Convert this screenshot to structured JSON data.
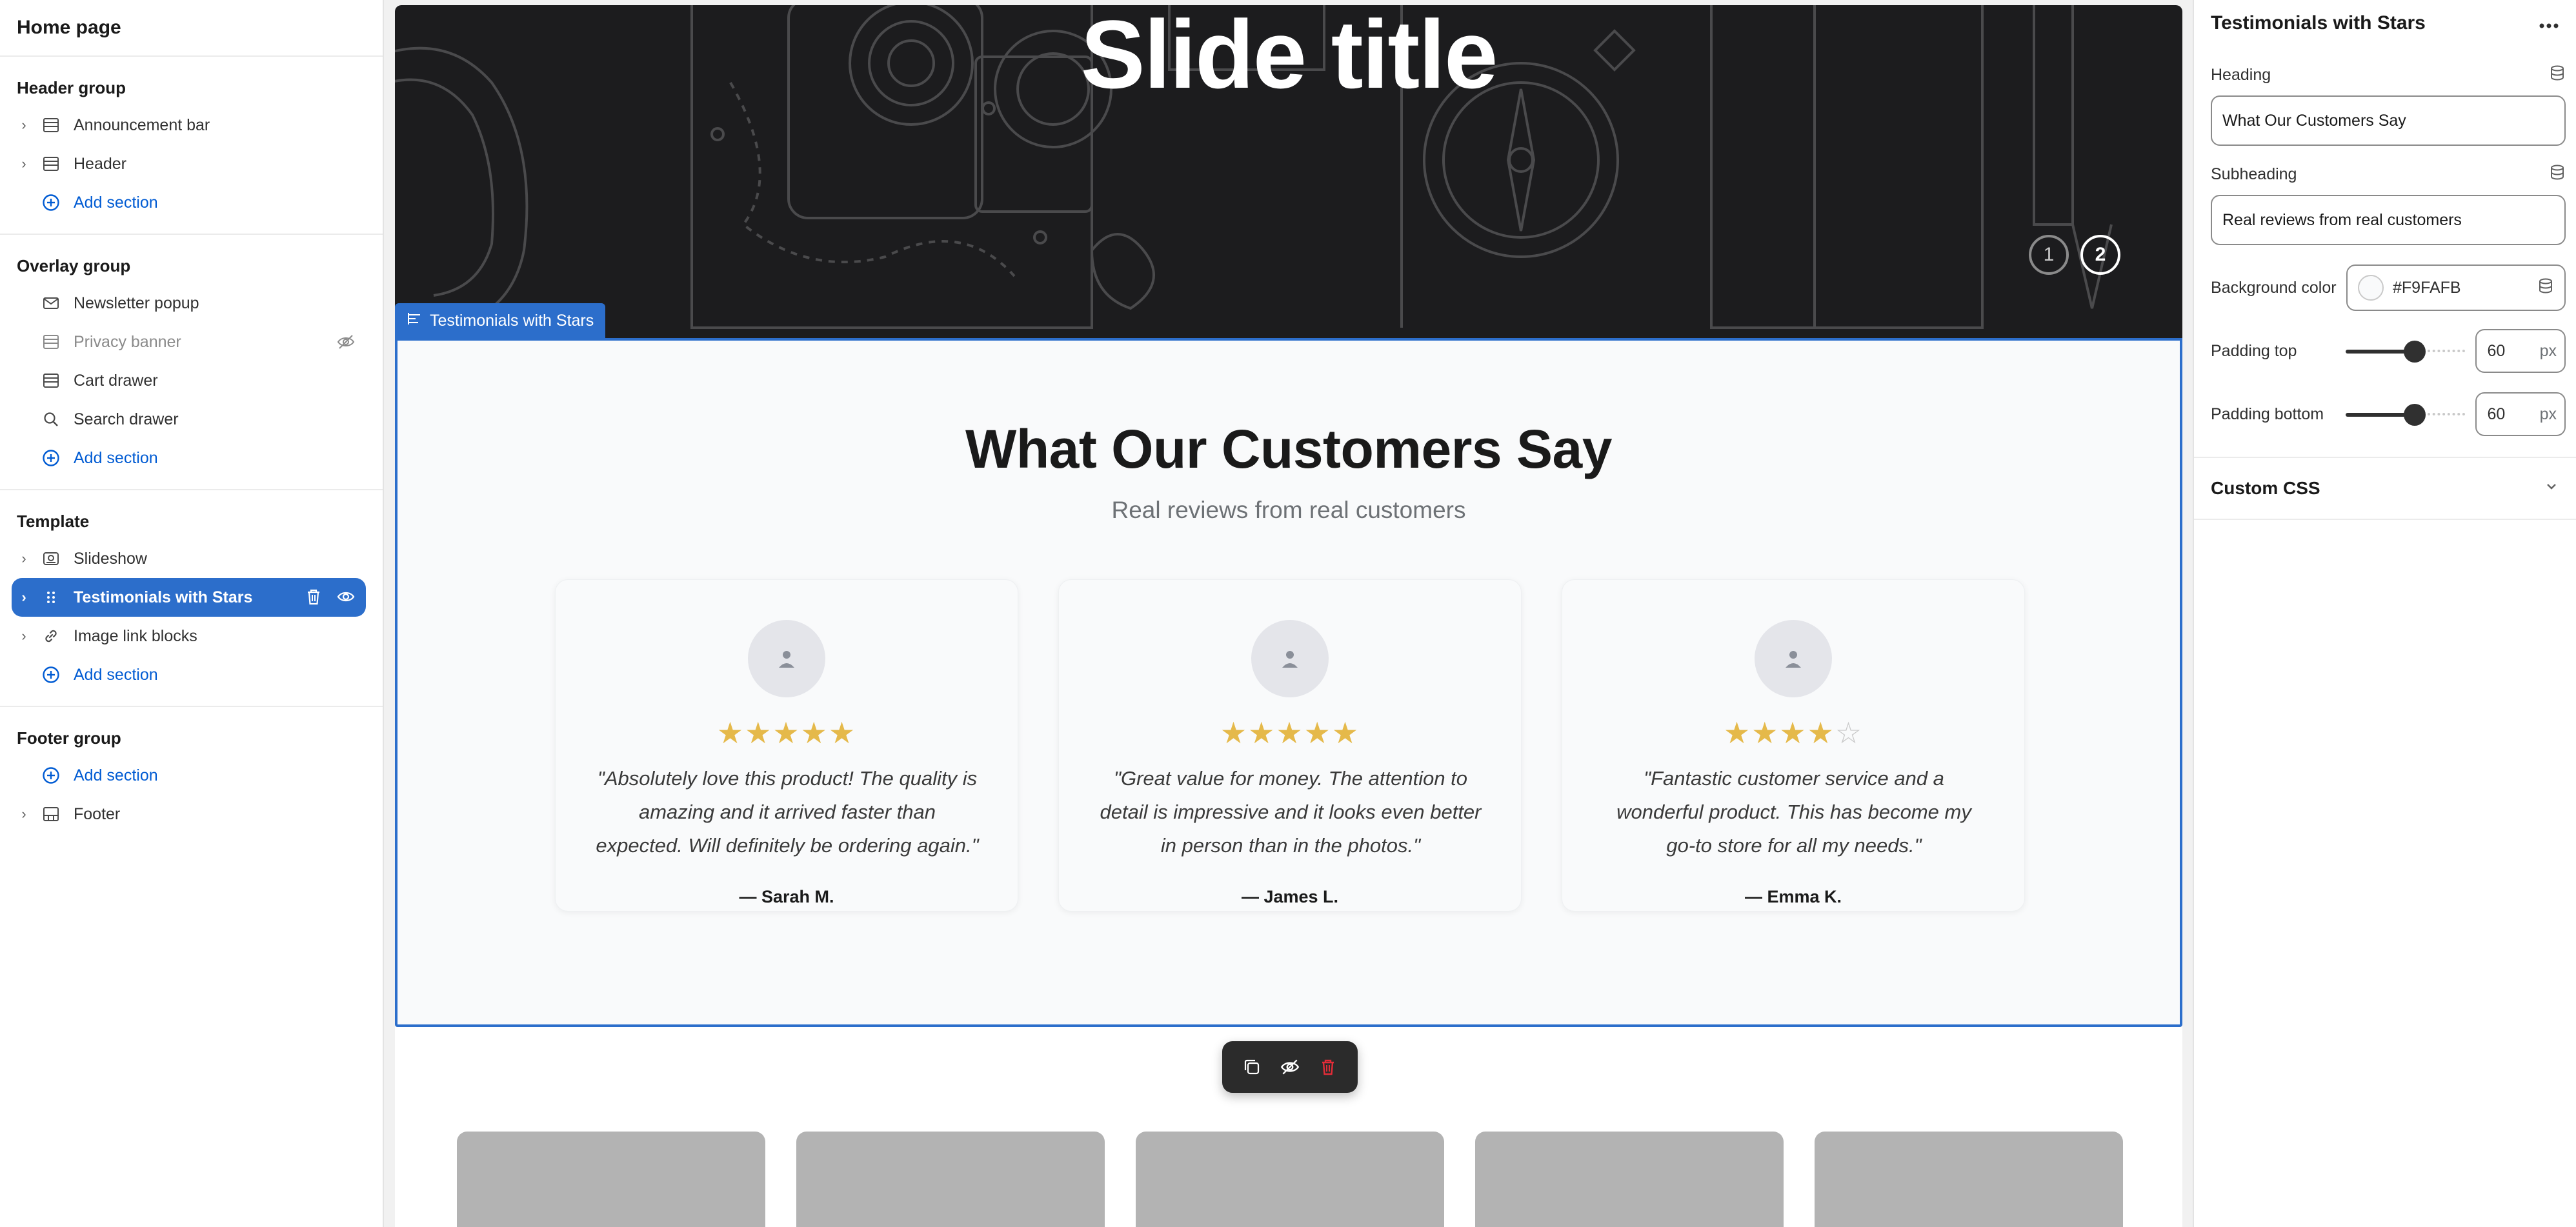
{
  "sidebar": {
    "title": "Home page",
    "groups": [
      {
        "title": "Header group",
        "items": [
          {
            "label": "Announcement bar",
            "icon": "section-icon"
          },
          {
            "label": "Header",
            "icon": "section-icon"
          }
        ],
        "add": "Add section"
      },
      {
        "title": "Overlay group",
        "items": [
          {
            "label": "Newsletter popup",
            "icon": "email-icon"
          },
          {
            "label": "Privacy banner",
            "icon": "section-icon",
            "hidden": true
          },
          {
            "label": "Cart drawer",
            "icon": "section-icon"
          },
          {
            "label": "Search drawer",
            "icon": "search-icon"
          }
        ],
        "add": "Add section"
      },
      {
        "title": "Template",
        "items": [
          {
            "label": "Slideshow",
            "icon": "slideshow-icon"
          },
          {
            "label": "Testimonials with Stars",
            "icon": "drag-handle-icon",
            "selected": true
          },
          {
            "label": "Image link blocks",
            "icon": "link-icon"
          }
        ],
        "add": "Add section"
      },
      {
        "title": "Footer group",
        "add": "Add section",
        "items": [
          {
            "label": "Footer",
            "icon": "section-icon"
          }
        ]
      }
    ]
  },
  "hero": {
    "title": "Slide title",
    "dots": [
      "1",
      "2"
    ],
    "active_dot": 2
  },
  "section_tag": "Testimonials with Stars",
  "testimonials": {
    "heading": "What Our Customers Say",
    "subheading": "Real reviews from real customers",
    "background": "#F9FAFB",
    "cards": [
      {
        "rating": 5,
        "quote": "\"Absolutely love this product! The quality is amazing and it arrived faster than expected. Will definitely be ordering again.\"",
        "author": "— Sarah M."
      },
      {
        "rating": 5,
        "quote": "\"Great value for money. The attention to detail is impressive and it looks even better in person than in the photos.\"",
        "author": "— James L."
      },
      {
        "rating": 4,
        "quote": "\"Fantastic customer service and a wonderful product. This has become my go-to store for all my needs.\"",
        "author": "— Emma K."
      }
    ]
  },
  "panel": {
    "title": "Testimonials with Stars",
    "heading_label": "Heading",
    "heading_value": "What Our Customers Say",
    "subheading_label": "Subheading",
    "subheading_value": "Real reviews from real customers",
    "bg_label": "Background color",
    "bg_value": "#F9FAFB",
    "padding_top_label": "Padding top",
    "padding_top_value": "60",
    "padding_bottom_label": "Padding bottom",
    "padding_bottom_value": "60",
    "unit": "px",
    "custom_css_label": "Custom CSS",
    "padding_top_fraction": 0.58,
    "padding_bottom_fraction": 0.58
  },
  "colors": {
    "accent": "#2c6ecb",
    "star": "#e5b94a",
    "link": "#005bd3",
    "delete": "#e22c38"
  }
}
